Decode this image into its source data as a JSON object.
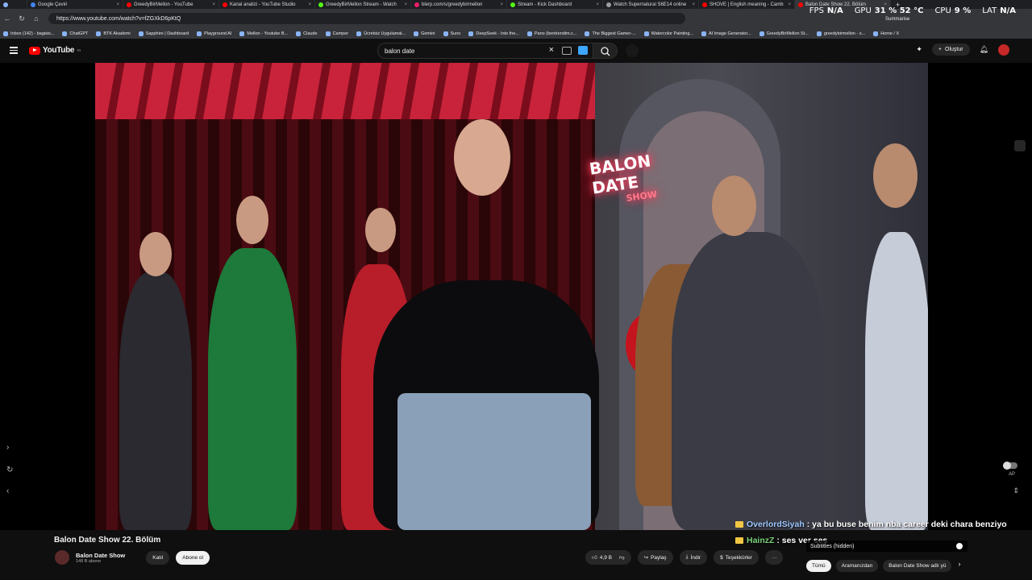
{
  "browser": {
    "tabs": [
      {
        "label": "",
        "color": "#8ab4f8"
      },
      {
        "label": "Google Çeviri",
        "color": "#4285f4"
      },
      {
        "label": "GreedyBirMellon - YouTube",
        "color": "#ff0000"
      },
      {
        "label": "Kanal analizi - YouTube Studio",
        "color": "#ff0000"
      },
      {
        "label": "GreedyBirMellon Stream - Watch",
        "color": "#53fc18"
      },
      {
        "label": "blerp.com/s/greedybirmellon",
        "color": "#e91e63"
      },
      {
        "label": "Stream - Kick Dashboard",
        "color": "#53fc18"
      },
      {
        "label": "Watch Supernatural S6E14 online",
        "color": "#9e9e9e"
      },
      {
        "label": "SHOVE | English meaning - Camb",
        "color": "#ff0000"
      },
      {
        "label": "Balon Date Show 22. Bölüm",
        "color": "#ff0000"
      }
    ],
    "url": "https://www.youtube.com/watch?v=fZGXkD6pKtQ",
    "bookmarks": [
      "Inbox (142) - bagisis...",
      "ChatGPT",
      "BTK Akademi",
      "Sapphire | Dashboard",
      "Playground AI",
      "Mellon - Youtube B...",
      "Claude",
      "Camper",
      "Ücretsiz Uygulamal...",
      "Gemini",
      "Suno",
      "DeepSeek - Into the...",
      "Pano (bentrendim.c...",
      "The Biggest Gamer-...",
      "Watercolor Painting...",
      "AI Image Generator...",
      "GreedyBirMellon St...",
      "greedybirmellon - s...",
      "Home / X"
    ]
  },
  "overlay": {
    "fps_label": "FPS",
    "fps_value": "N/A",
    "gpu_label": "GPU",
    "gpu_value": "31 % 52 °C",
    "cpu_label": "CPU",
    "cpu_value": "9 %",
    "lat_label": "LAT",
    "lat_value": "N/A",
    "summarise": "Summarise"
  },
  "youtube": {
    "logo_text": "YouTube",
    "region": "TR",
    "search_value": "balon date",
    "create_label": "Oluştur"
  },
  "video": {
    "neon_line1": "BALON DATE",
    "neon_line2": "SHOW",
    "title": "Balon Date Show 22. Bölüm",
    "channel_name": "Balon Date Show",
    "channel_subs": "148 B abone",
    "join_label": "Katıl",
    "subscribe_label": "Abone ol",
    "like_count": "4,9 B",
    "share_label": "Paylaş",
    "download_label": "İndir",
    "thanks_label": "Teşekkürler",
    "more_label": "···"
  },
  "chat": [
    {
      "user": "OverlordSiyah",
      "message": " : ya bu buse benim nba career deki chara benziyo"
    },
    {
      "user": "HainzZ",
      "message": " : ses ver ses"
    }
  ],
  "subtitles_label": "Subtitles (hidden)",
  "ap_label": "AP",
  "chips": [
    "Tümü",
    "Aramanızdan",
    "Balon Date Show adlı yü"
  ]
}
